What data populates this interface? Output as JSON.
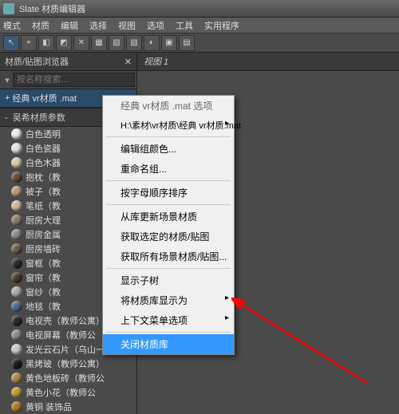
{
  "title": "Slate 材质编辑器",
  "menubar": [
    "模式",
    "材质",
    "编辑",
    "选择",
    "视图",
    "选项",
    "工具",
    "实用程序"
  ],
  "panel": {
    "title": "材质/贴图浏览器",
    "search_placeholder": "按名称搜索..."
  },
  "library": {
    "prefix": "+",
    "name": "经典 vr材质 .mat"
  },
  "category": {
    "prefix": "-",
    "name": "吴希材质参数"
  },
  "materials": [
    {
      "label": "白色透明",
      "color": "#e8e8e8"
    },
    {
      "label": "白色瓷器",
      "color": "#e0e0e0"
    },
    {
      "label": "白色木器",
      "color": "#d8c8a8"
    },
    {
      "label": "抱枕（教",
      "color": "#6a4a3a"
    },
    {
      "label": "被子（教",
      "color": "#b89878"
    },
    {
      "label": "笔纸（教",
      "color": "#c8b898"
    },
    {
      "label": "厨房大理",
      "color": "#8a7a6a"
    },
    {
      "label": "厨房金属",
      "color": "#888"
    },
    {
      "label": "厨房墙砖",
      "color": "#6a5a4a"
    },
    {
      "label": "窗框（教",
      "color": "#2a2a2a"
    },
    {
      "label": "窗帘（教",
      "color": "#4a3a2a"
    },
    {
      "label": "窗纱（教",
      "color": "#aaa"
    },
    {
      "label": "地毯（教",
      "color": "#4a6a8a"
    },
    {
      "label": "电视壳（教师公寓）",
      "color": "#2a2a2a"
    },
    {
      "label": "电视屏幕（教师公",
      "color": "#888"
    },
    {
      "label": "发光云石片（乌山一",
      "color": "#c8c8c8"
    },
    {
      "label": "黑烤玻（教师公寓）",
      "color": "#1a1a1a"
    },
    {
      "label": "黄色地板砖（教师公",
      "color": "#a88848"
    },
    {
      "label": "黄色小花（教师公",
      "color": "#b89838"
    },
    {
      "label": "黄铜 装饰品",
      "color": "#a87828"
    }
  ],
  "viewtab": "视图 1",
  "context_menu": {
    "header1": "经典 vr材质 .mat 选项",
    "header2": "H:\\素材\\vr材质\\经典 vr材质.mat",
    "items": [
      {
        "label": "编辑组颜色..."
      },
      {
        "label": "重命名组..."
      },
      {
        "sep": true
      },
      {
        "label": "按字母顺序排序"
      },
      {
        "sep": true
      },
      {
        "label": "从库更新场景材质"
      },
      {
        "label": "获取选定的材质/贴图"
      },
      {
        "label": "获取所有场景材质/贴图..."
      },
      {
        "sep": true
      },
      {
        "label": "显示子树"
      },
      {
        "label": "将材质库显示为",
        "sub": true
      },
      {
        "label": "上下文菜单选项",
        "sub": true
      },
      {
        "sep": true
      },
      {
        "label": "关闭材质库",
        "hl": true
      }
    ]
  }
}
